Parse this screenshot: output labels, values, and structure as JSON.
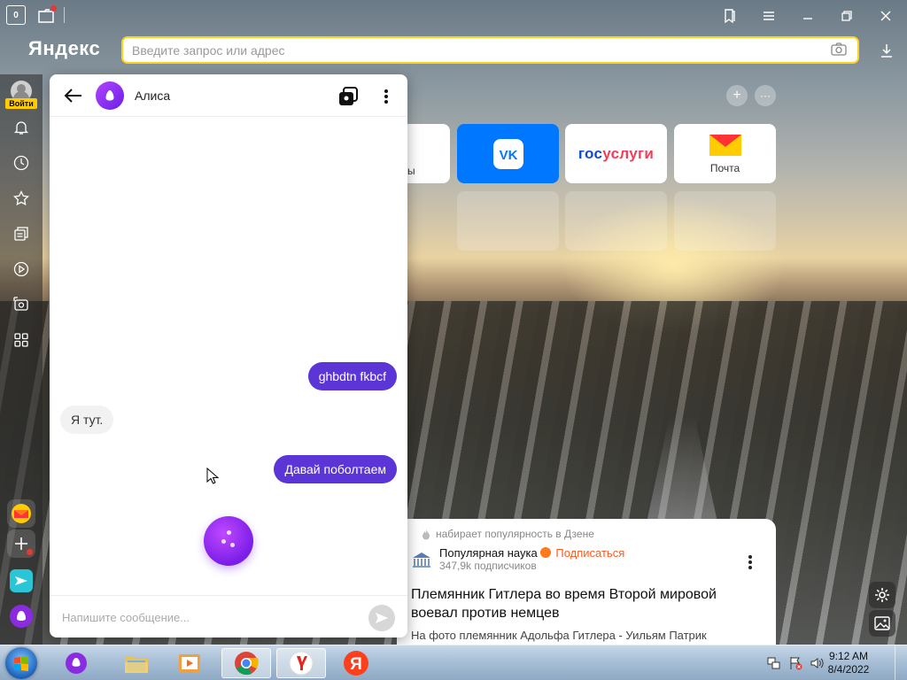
{
  "browser": {
    "logo": "Яндекс",
    "tab_count": "0",
    "address_placeholder": "Введите запрос или адрес",
    "login_label": "Войти"
  },
  "tiles": [
    {
      "label": "ы"
    },
    {
      "label": "VK"
    },
    {
      "label_a": "гос",
      "label_b": "услуги"
    },
    {
      "label": "Почта"
    }
  ],
  "chat": {
    "title": "Алиса",
    "messages": [
      {
        "from": "user",
        "text": "ghbdtn fkbcf"
      },
      {
        "from": "bot",
        "text": "Я тут."
      },
      {
        "from": "user",
        "text": "Давай поболтаем"
      }
    ],
    "input_placeholder": "Напишите сообщение..."
  },
  "news": {
    "source": "набирает популярность в Дзене",
    "publisher": "Популярная наука",
    "subscribe": "Подписаться",
    "subscribers": "347,9k подписчиков",
    "title": "Племянник Гитлера во время Второй мировой воевал против немцев",
    "text": "На фото племянник Адольфа Гитлера - Уильям Патрик"
  },
  "taskbar": {
    "time": "9:12 AM",
    "date": "8/4/2022"
  },
  "colors": {
    "accent_yellow": "#ffd21f",
    "alice_purple": "#5b35d5",
    "vk_blue": "#0077ff",
    "subscribe_orange": "#ff5a1f"
  }
}
